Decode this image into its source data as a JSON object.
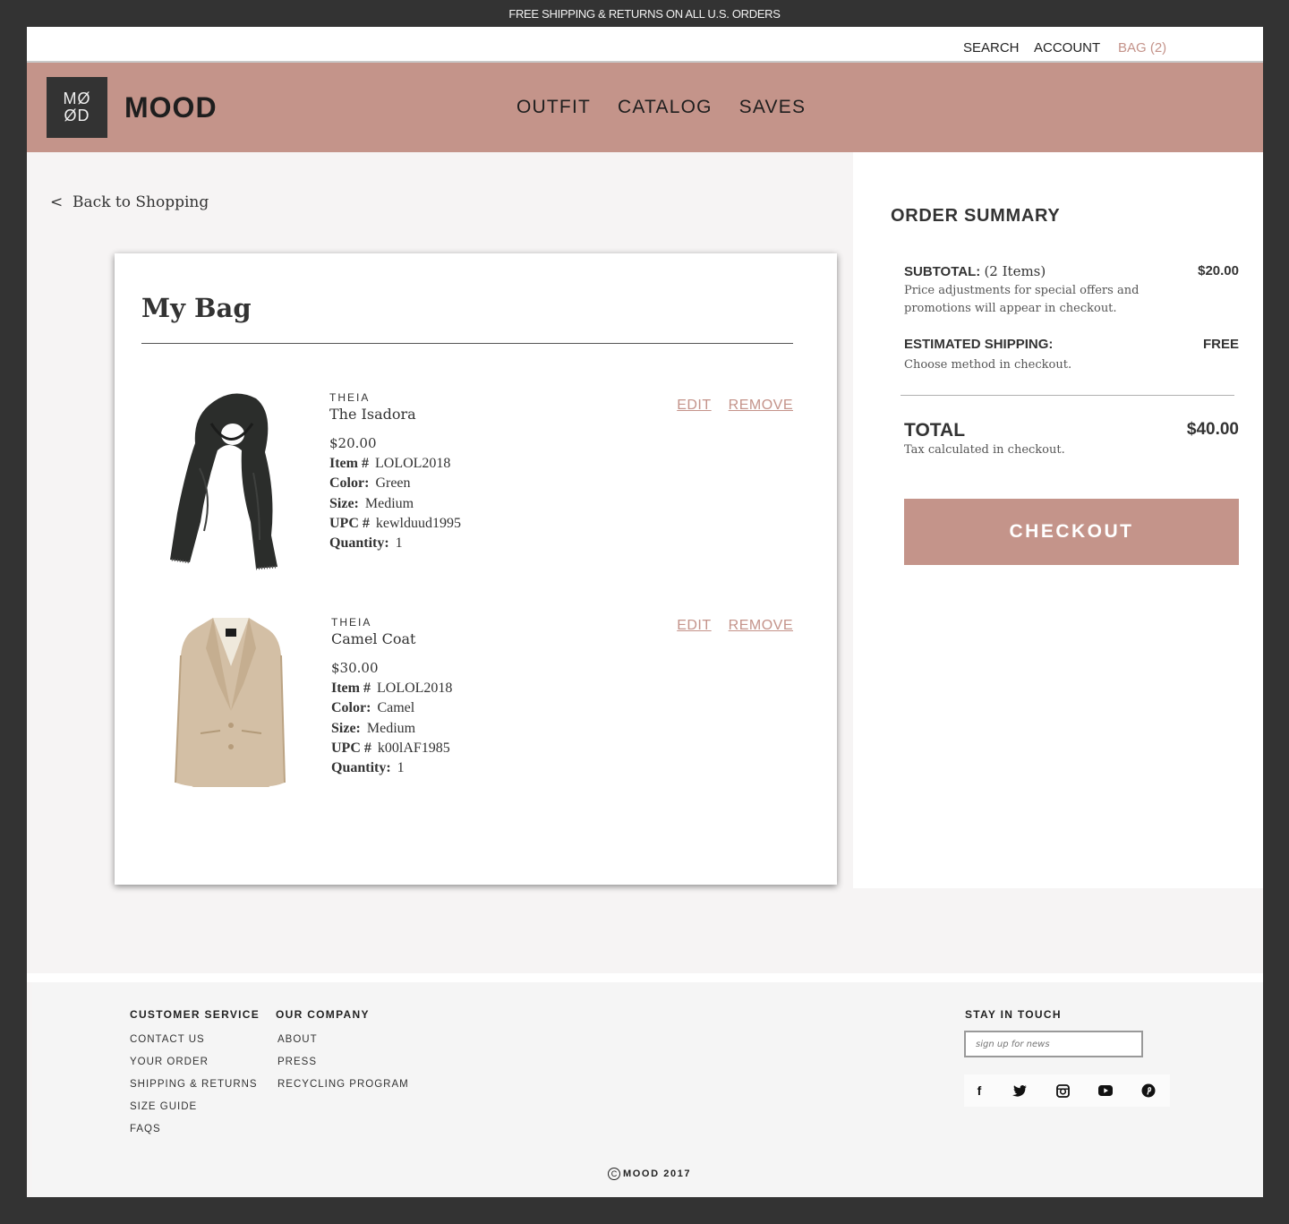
{
  "promo": {
    "text": "FREE SHIPPING & RETURNS ON ALL U.S. ORDERS"
  },
  "utility": {
    "search": "SEARCH",
    "account": "ACCOUNT",
    "bag": "BAG (2)"
  },
  "header": {
    "logo_top": "MØ",
    "logo_bottom": "ØD",
    "brand": "MOOD",
    "nav": [
      "OUTFIT",
      "CATALOG",
      "SAVES"
    ]
  },
  "back_link": "<  Back to Shopping",
  "bag": {
    "title": "My Bag",
    "items": [
      {
        "image": "scarf-image",
        "brand": "THEIA",
        "name": "The Isadora",
        "price": "$20.00",
        "item_label": "Item #",
        "item_no": "LOLOL2018",
        "color_label": "Color:",
        "color": "Green",
        "size_label": "Size:",
        "size": "Medium",
        "upc_label": "UPC #",
        "upc": "kewlduud1995",
        "qty_label": "Quantity:",
        "qty": "1",
        "edit": "EDIT",
        "remove": "REMOVE"
      },
      {
        "image": "blazer-image",
        "brand": "THEIA",
        "name": "Camel Coat",
        "price": "$30.00",
        "item_label": "Item #",
        "item_no": "LOLOL2018",
        "color_label": "Color:",
        "color": "Camel",
        "size_label": "Size:",
        "size": "Medium",
        "upc_label": "UPC #",
        "upc": "k00lAF1985",
        "qty_label": "Quantity:",
        "qty": "1",
        "edit": "EDIT",
        "remove": "REMOVE"
      }
    ]
  },
  "summary": {
    "title": "ORDER SUMMARY",
    "subtotal_label": "SUBTOTAL:",
    "subtotal_items": "(2 Items)",
    "subtotal_value": "$20.00",
    "subtotal_note": "Price adjustments for special offers and promotions will appear in checkout.",
    "shipping_label": "ESTIMATED SHIPPING:",
    "shipping_value": "FREE",
    "shipping_note": "Choose method in checkout.",
    "total_label": "TOTAL",
    "total_value": "$40.00",
    "total_note": "Tax calculated in checkout.",
    "checkout": "CHECKOUT"
  },
  "footer": {
    "customer_service": {
      "heading": "CUSTOMER SERVICE",
      "links": [
        "CONTACT US",
        "YOUR ORDER",
        "SHIPPING & RETURNS",
        "SIZE GUIDE",
        "FAQS"
      ]
    },
    "company": {
      "heading": "OUR COMPANY",
      "links": [
        "ABOUT",
        "PRESS",
        "RECYCLING PROGRAM"
      ]
    },
    "stay_in_touch": {
      "heading": "STAY IN TOUCH",
      "placeholder": "sign up for news",
      "social": [
        "facebook-icon",
        "twitter-icon",
        "instagram-icon",
        "youtube-icon",
        "pinterest-icon"
      ]
    },
    "copyright": "MOOD 2017"
  },
  "colors": {
    "accent": "#c4948a",
    "dark": "#333333"
  }
}
